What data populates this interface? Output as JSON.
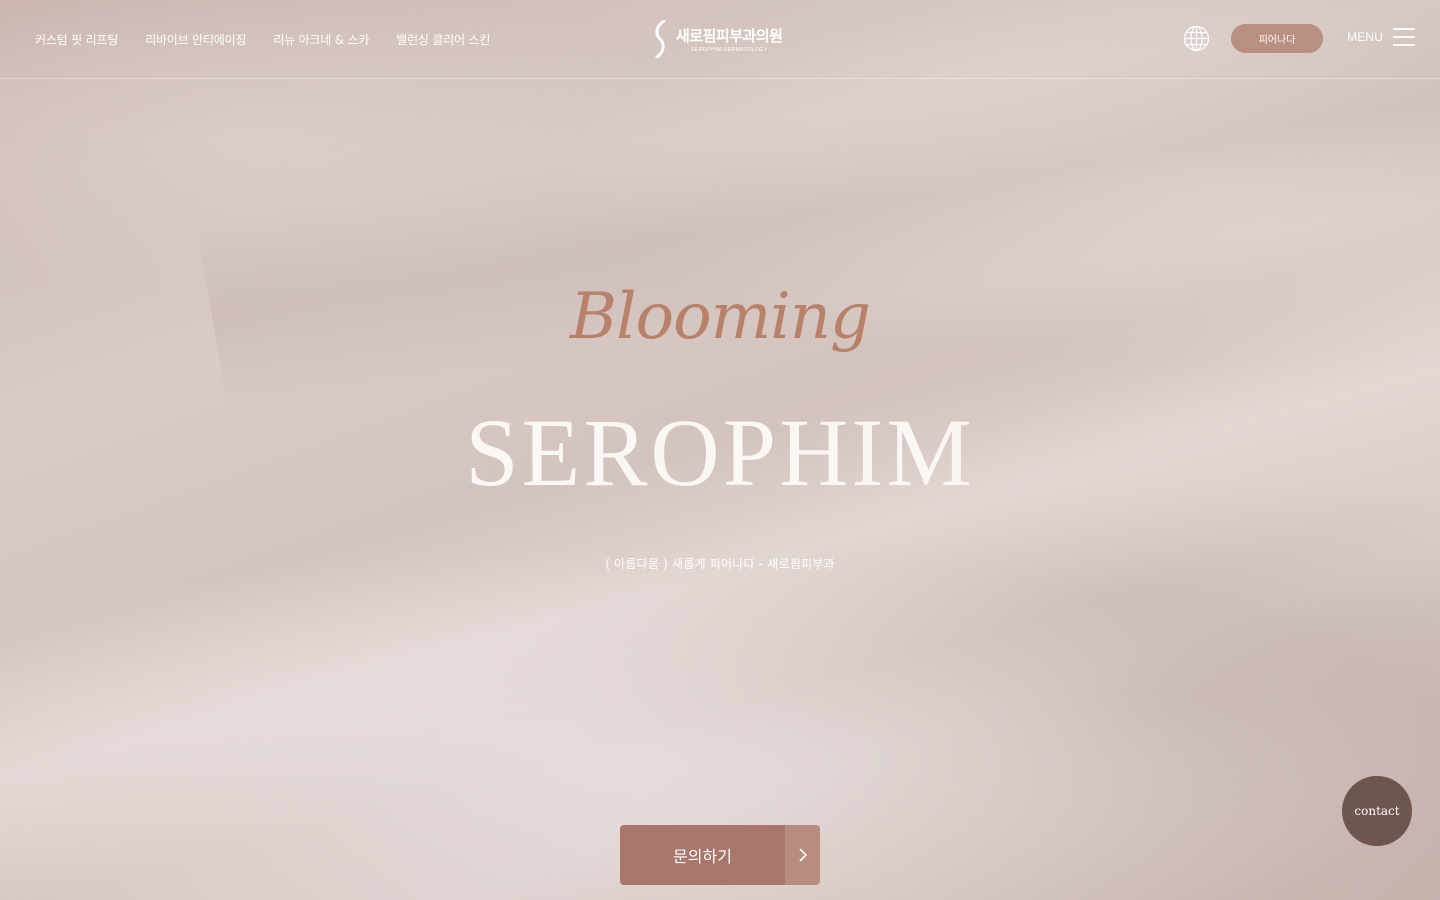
{
  "nav": {
    "items": [
      {
        "label": "커스텀 핏 리프팅"
      },
      {
        "label": "리바이브 안티에이징"
      },
      {
        "label": "리뉴 아크네 & 스카"
      },
      {
        "label": "밸런싱 클리어 스킨"
      }
    ]
  },
  "logo": {
    "name_ko": "새로핌피부과의원",
    "name_en": "SEROPHIM DERMATOLOGY"
  },
  "header": {
    "globe_icon": "globe-icon",
    "bloom_button": "피어나다",
    "menu_label": "MENU"
  },
  "hero": {
    "script_title": "Blooming",
    "brand": "SEROPHIM",
    "tagline": "( 아름다움 ) 새롭게 피어나다 - 새로핌피부과"
  },
  "cta": {
    "inquiry_label": "문의하기",
    "arrow_icon": "chevron-right-icon"
  },
  "contact": {
    "label": "contact"
  },
  "colors": {
    "accent": "#b88f80",
    "script": "#b8826a",
    "cta": "#a9766c",
    "contact": "#6e5550"
  }
}
